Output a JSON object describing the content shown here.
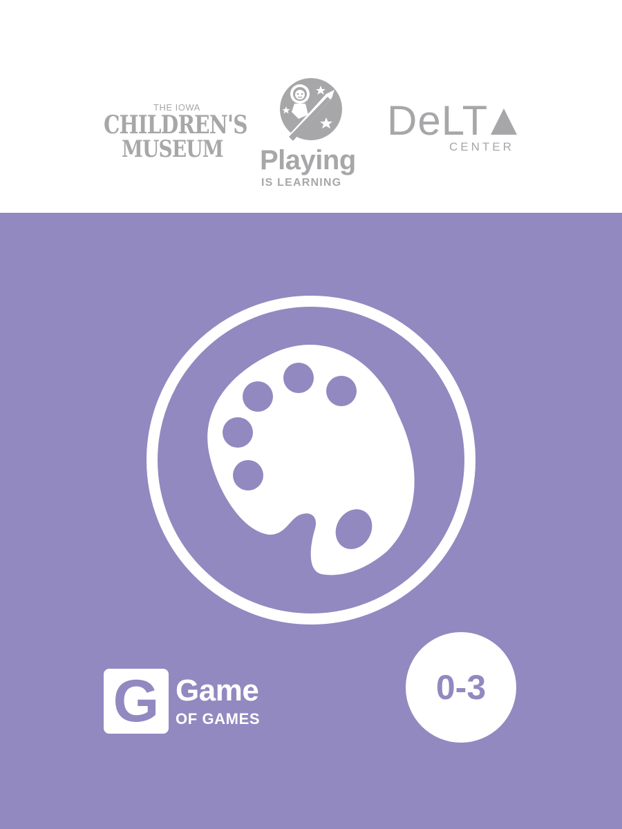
{
  "logos": {
    "museum": {
      "line1": "THE IOWA",
      "line2": "CHILDREN'S",
      "line3": "MUSEUM"
    },
    "playing": {
      "line1": "Playing",
      "line2": "IS LEARNING"
    },
    "delta": {
      "line1": "DeLT",
      "line2": "CENTER"
    }
  },
  "card": {
    "icon": "artist-palette-icon",
    "brand": {
      "letter": "G",
      "line1": "Game",
      "line2": "OF GAMES"
    },
    "age": "0-3"
  },
  "colors": {
    "background": "#9289c0",
    "logo_gray": "#a7a7a9",
    "white": "#ffffff"
  }
}
